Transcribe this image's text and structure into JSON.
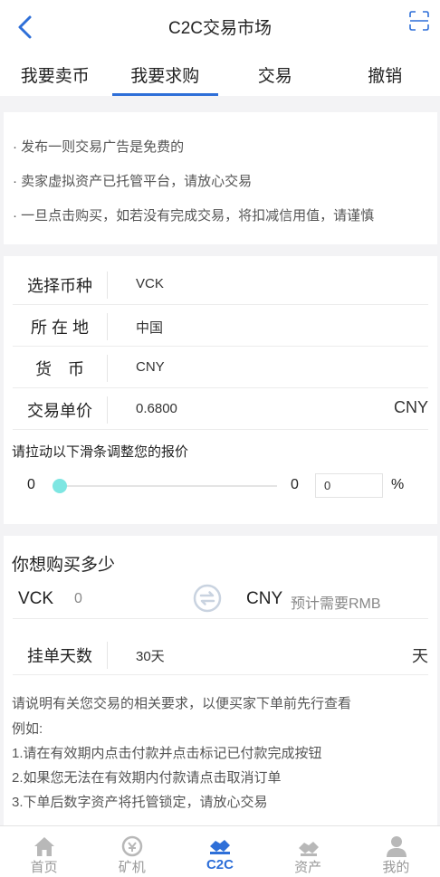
{
  "header": {
    "title": "C2C交易市场"
  },
  "tabs": [
    {
      "label": "我要卖币"
    },
    {
      "label": "我要求购"
    },
    {
      "label": "交易"
    },
    {
      "label": "撤销"
    }
  ],
  "notices": [
    "· 发布一则交易广告是免费的",
    "· 卖家虚拟资产已托管平台，请放心交易",
    "· 一旦点击购买，如若没有完成交易，将扣减信用值，请谨慎"
  ],
  "form": {
    "coin_label": "选择币种",
    "coin_value": "VCK",
    "location_label": "所 在 地",
    "location_value": "中国",
    "currency_label": "货　币",
    "currency_value": "CNY",
    "price_label": "交易单价",
    "price_value": "0.6800",
    "price_unit": "CNY",
    "slider_hint": "请拉动以下滑条调整您的报价",
    "slider_min": "0",
    "slider_max": "0",
    "slider_level": 0,
    "percent_value": "0",
    "percent_sign": "%"
  },
  "buy": {
    "title": "你想购买多少",
    "coin": "VCK",
    "coin_amount": "0",
    "currency": "CNY",
    "currency_placeholder": "预计需要RMB",
    "days_label": "挂单天数",
    "days_value": "30天",
    "days_unit": "天",
    "notes": [
      "请说明有关您交易的相关要求，以便买家下单前先行查看",
      "例如:",
      "1.请在有效期内点击付款并点击标记已付款完成按钮",
      "2.如果您无法在有效期内付款请点击取消订单",
      "3.下单后数字资产将托管锁定，请放心交易"
    ]
  },
  "bottom_nav": [
    {
      "label": "首页",
      "icon": "home-icon"
    },
    {
      "label": "矿机",
      "icon": "miner-icon"
    },
    {
      "label": "C2C",
      "icon": "c2c-icon",
      "active": true
    },
    {
      "label": "资产",
      "icon": "assets-icon"
    },
    {
      "label": "我的",
      "icon": "profile-icon"
    }
  ],
  "colors": {
    "accent": "#2e6fd8",
    "slider_thumb": "#7ee6e2"
  }
}
